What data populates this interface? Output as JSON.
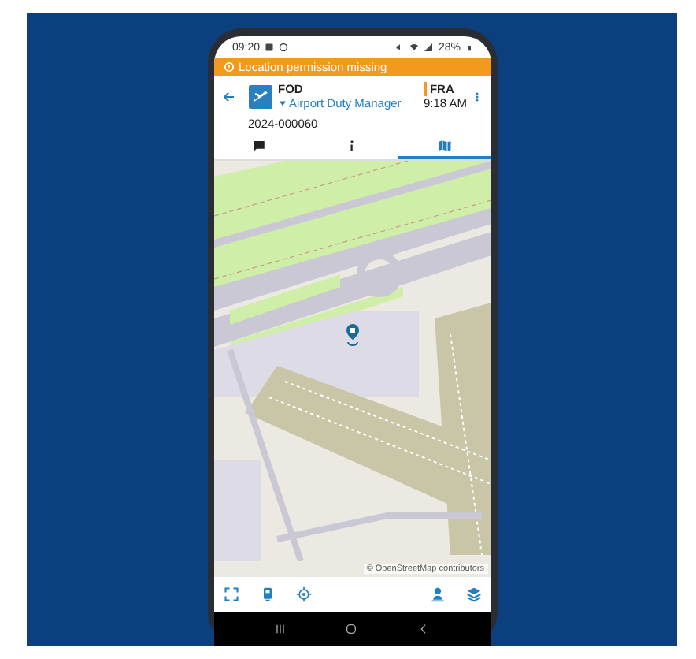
{
  "status_bar": {
    "time": "09:20",
    "battery": "28%"
  },
  "banner": {
    "text": "Location permission missing"
  },
  "header": {
    "title": "FOD",
    "airport": "FRA",
    "role": "Airport Duty Manager",
    "time": "9:18 AM",
    "reference": "2024-000060"
  },
  "tabs": [
    {
      "kind": "chat",
      "selected": false
    },
    {
      "kind": "info",
      "selected": false
    },
    {
      "kind": "map",
      "selected": true
    }
  ],
  "map": {
    "attribution": "© OpenStreetMap contributors"
  },
  "toolbar": [
    {
      "kind": "fullscreen"
    },
    {
      "kind": "badge"
    },
    {
      "kind": "locate"
    },
    {
      "kind": "spacer"
    },
    {
      "kind": "person-pin"
    },
    {
      "kind": "layers"
    }
  ]
}
